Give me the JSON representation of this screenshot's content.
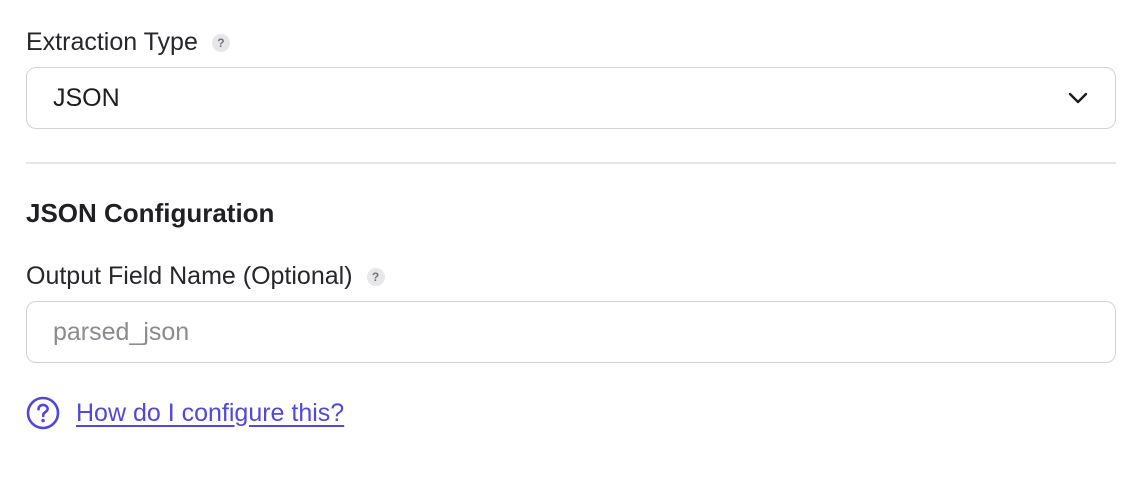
{
  "extraction": {
    "label": "Extraction Type",
    "help_glyph": "?",
    "selected_value": "JSON",
    "chevron_icon": "chevron-down-icon"
  },
  "json_config": {
    "title": "JSON Configuration",
    "output_field": {
      "label": "Output Field Name (Optional)",
      "help_glyph": "?",
      "value": "",
      "placeholder": "parsed_json"
    }
  },
  "help_link": {
    "icon": "question-circle-icon",
    "text": "How do I configure this?"
  },
  "colors": {
    "link": "#5147dd",
    "border": "#d2d2d6",
    "divider": "#e6e6e9"
  }
}
